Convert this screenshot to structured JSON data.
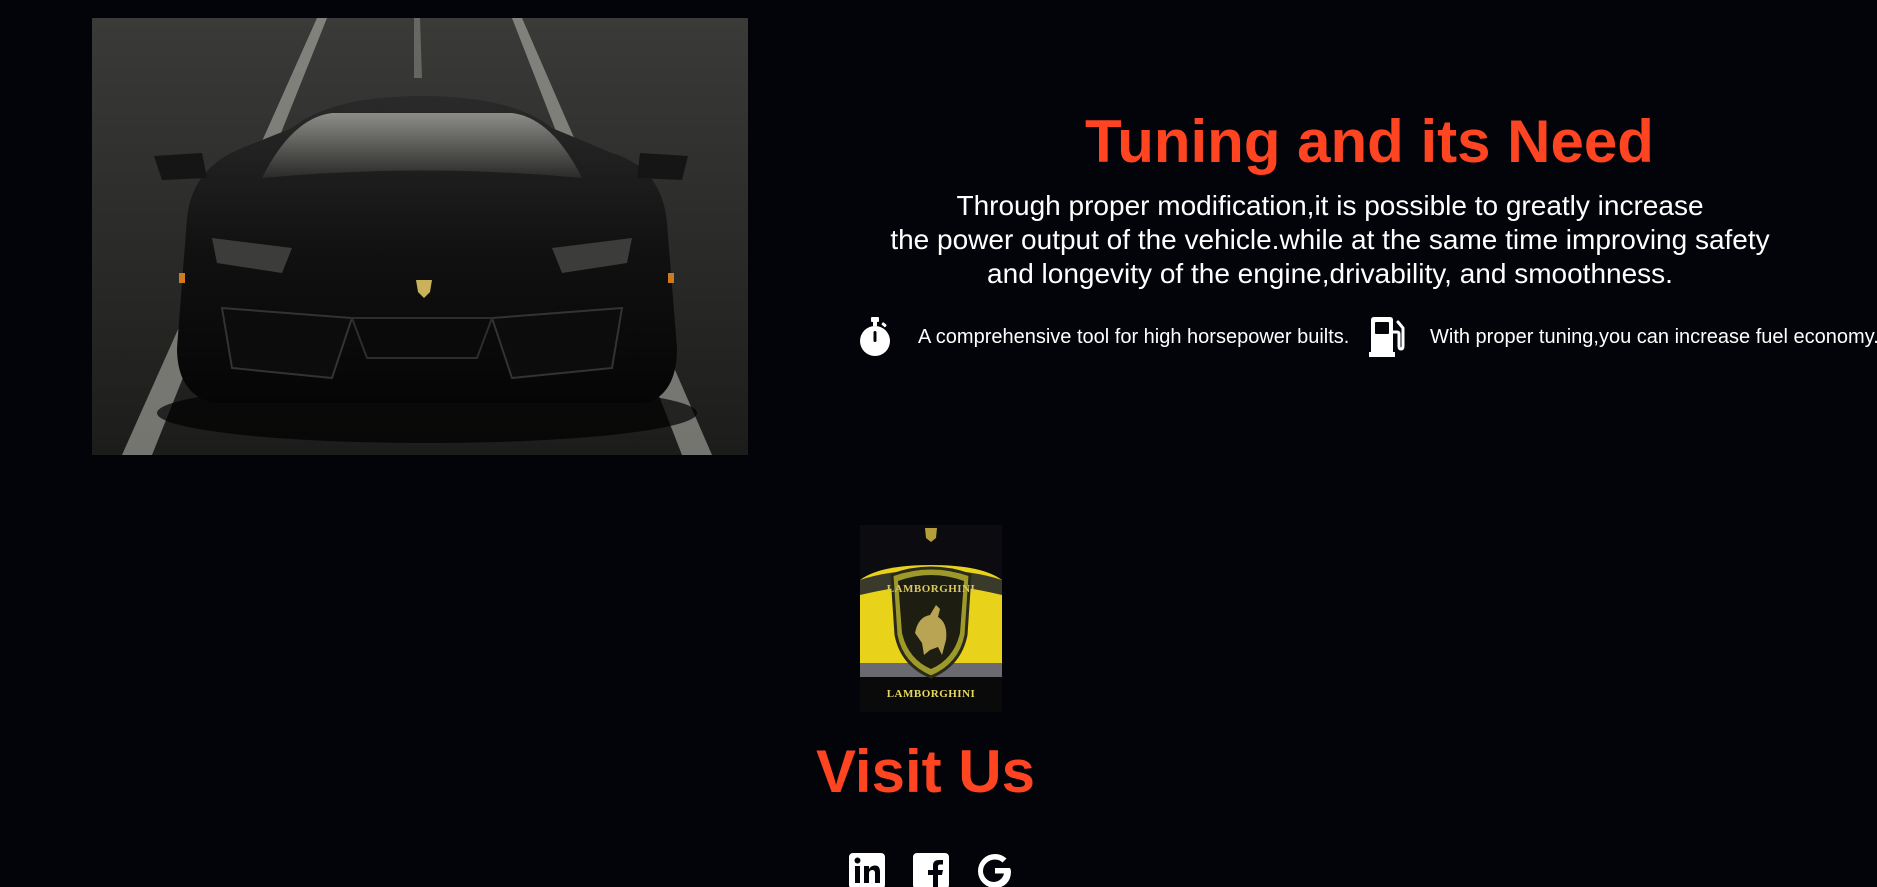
{
  "tuning": {
    "title": "Tuning and its Need",
    "description_lines": [
      "Through proper modification,it is possible to greatly increase",
      "the power output of the vehicle.while at the same time improving safety",
      "and longevity of the engine,drivability, and smoothness."
    ],
    "features": [
      {
        "icon": "stopwatch-icon",
        "text": "A comprehensive tool for high horsepower builts."
      },
      {
        "icon": "fuel-pump-icon",
        "text": "With proper tuning,you can increase fuel economy."
      }
    ]
  },
  "logo": {
    "brand_text": "LAMBORGHINI",
    "shield_text": "LAMBORGHINI"
  },
  "visit": {
    "title": "Visit Us",
    "socials": [
      {
        "icon": "linkedin-icon",
        "label": "LinkedIn"
      },
      {
        "icon": "facebook-icon",
        "label": "Facebook"
      },
      {
        "icon": "google-icon",
        "label": "Google"
      }
    ]
  },
  "colors": {
    "background": "#03040a",
    "accent": "#ff4422",
    "text": "#ffffff"
  }
}
